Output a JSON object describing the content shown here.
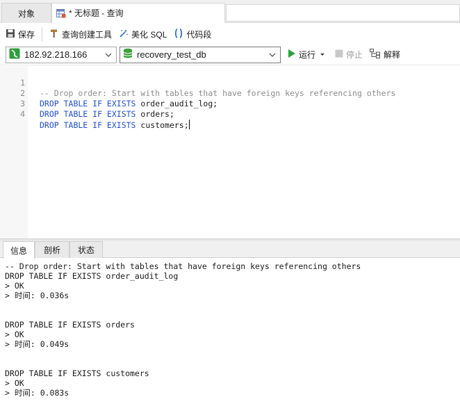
{
  "tabs": {
    "objects_label": "对象",
    "query_label": "* 无标题 - 查询"
  },
  "toolbar": {
    "save_label": "保存",
    "query_builder_label": "查询创建工具",
    "beautify_label": "美化 SQL",
    "snippet_label": "代码段"
  },
  "connection": {
    "host": "182.92.218.166",
    "database": "recovery_test_db",
    "run_label": "运行",
    "stop_label": "停止",
    "explain_label": "解释"
  },
  "editor": {
    "lines": [
      {
        "num": "1",
        "comment": "-- Drop order: Start with tables that have foreign keys referencing others"
      },
      {
        "num": "2",
        "kw": "DROP TABLE IF EXISTS",
        "ident": "order_audit_log;"
      },
      {
        "num": "3",
        "kw": "DROP TABLE IF EXISTS",
        "ident": "orders;"
      },
      {
        "num": "4",
        "kw": "DROP TABLE IF EXISTS",
        "ident": "customers;"
      }
    ]
  },
  "result_tabs": {
    "info": "信息",
    "profile": "剖析",
    "status": "状态"
  },
  "output": {
    "lines": [
      "-- Drop order: Start with tables that have foreign keys referencing others",
      "DROP TABLE IF EXISTS order_audit_log",
      "> OK",
      "> 时间: 0.036s",
      "",
      "",
      "DROP TABLE IF EXISTS orders",
      "> OK",
      "> 时间: 0.049s",
      "",
      "",
      "DROP TABLE IF EXISTS customers",
      "> OK",
      "> 时间: 0.083s"
    ]
  },
  "colors": {
    "keyword": "#1f4fd6",
    "comment": "#8c8c8c",
    "run_green": "#2e9e3e",
    "db_green": "#3aa13a"
  }
}
